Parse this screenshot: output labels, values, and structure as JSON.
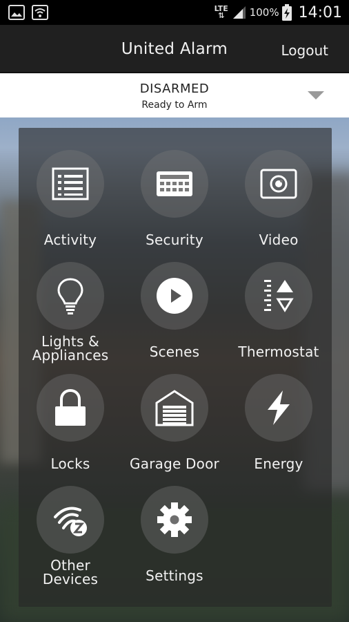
{
  "status_bar": {
    "network_label": "LTE",
    "battery_percent": "100%",
    "time": "14:01",
    "icons": [
      "gallery-icon",
      "wifi-icon",
      "lte-icon",
      "signal-icon",
      "battery-charging-icon"
    ]
  },
  "header": {
    "title": "United Alarm",
    "logout_label": "Logout"
  },
  "arm_status": {
    "state": "DISARMED",
    "subtitle": "Ready to Arm"
  },
  "menu": {
    "activity": "Activity",
    "security": "Security",
    "video": "Video",
    "lights_line1": "Lights &",
    "lights_line2": "Appliances",
    "scenes": "Scenes",
    "thermostat": "Thermostat",
    "locks": "Locks",
    "garage": "Garage Door",
    "energy": "Energy",
    "other_line1": "Other",
    "other_line2": "Devices",
    "settings": "Settings"
  },
  "colors": {
    "header_bg": "#202020",
    "arm_bar_bg": "#ffffff",
    "icon_circle": "#787878",
    "text": "#f2f2f2"
  }
}
